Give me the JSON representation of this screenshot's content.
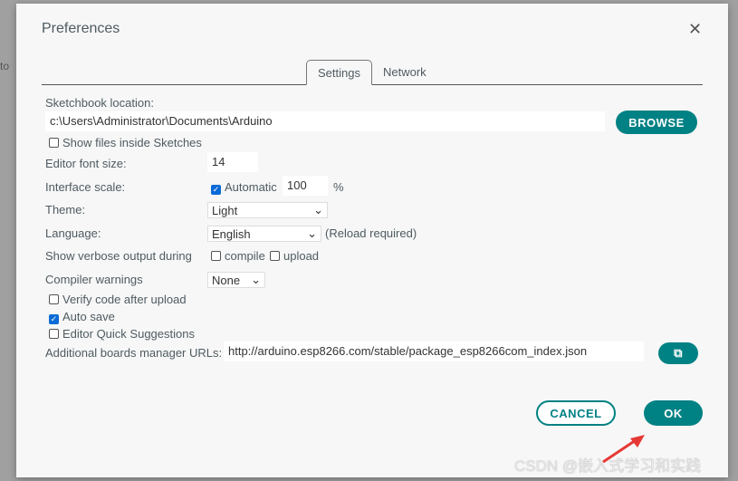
{
  "background_text": "to",
  "dialog": {
    "title": "Preferences",
    "close_icon": "close-icon"
  },
  "tabs": [
    {
      "label": "Settings",
      "active": true
    },
    {
      "label": "Network",
      "active": false
    }
  ],
  "settings": {
    "sketchbook_label": "Sketchbook location:",
    "sketchbook_value": "c:\\Users\\Administrator\\Documents\\Arduino",
    "browse_label": "BROWSE",
    "show_files_label": "Show files inside Sketches",
    "show_files_checked": false,
    "font_size_label": "Editor font size:",
    "font_size_value": "14",
    "scale_label": "Interface scale:",
    "automatic_label": "Automatic",
    "automatic_checked": true,
    "scale_value": "100",
    "scale_unit": "%",
    "theme_label": "Theme:",
    "theme_value": "Light",
    "language_label": "Language:",
    "language_value": "English",
    "reload_note": "(Reload required)",
    "verbose_label": "Show verbose output during",
    "compile_label": "compile",
    "compile_checked": false,
    "upload_label": "upload",
    "upload_checked": false,
    "warnings_label": "Compiler warnings",
    "warnings_value": "None",
    "verify_label": "Verify code after upload",
    "verify_checked": false,
    "autosave_label": "Auto save",
    "autosave_checked": true,
    "quick_label": "Editor Quick Suggestions",
    "quick_checked": false,
    "urls_label": "Additional boards manager URLs:",
    "urls_value": "http://arduino.esp8266.com/stable/package_esp8266com_index.json",
    "urls_button_icon": "open-window-icon"
  },
  "footer": {
    "cancel_label": "CANCEL",
    "ok_label": "OK"
  },
  "watermark": "CSDN @嵌入式学习和实践",
  "colors": {
    "accent": "#008184",
    "arrow": "#e53935"
  }
}
